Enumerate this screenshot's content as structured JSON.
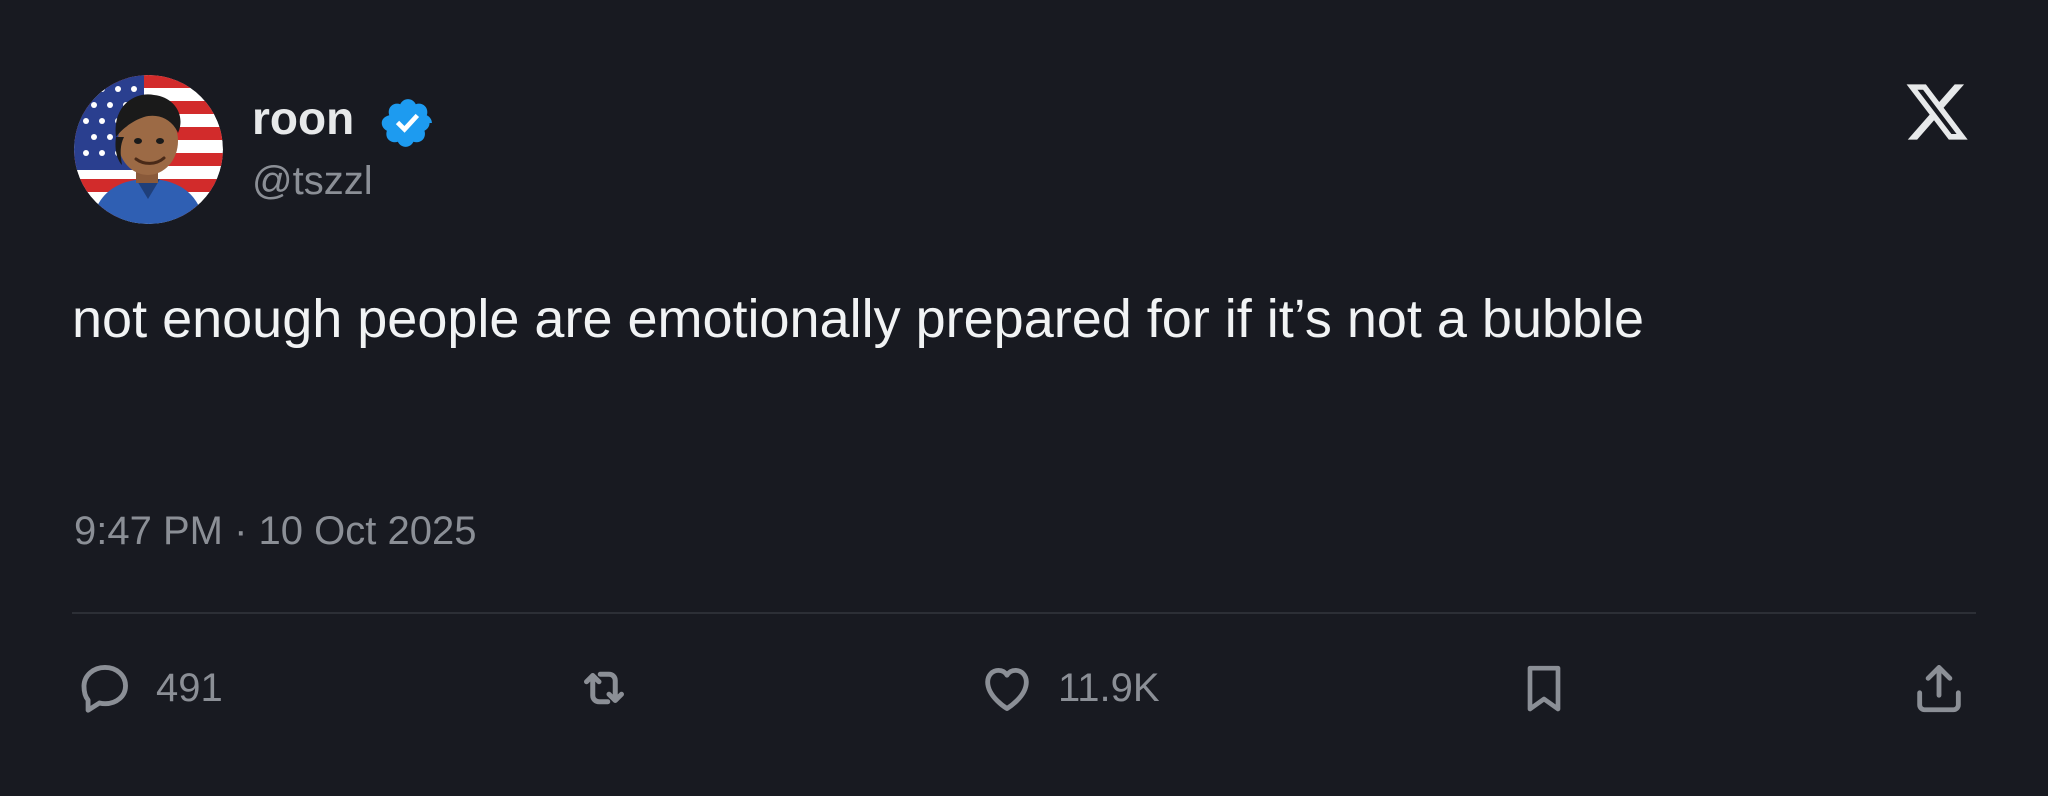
{
  "author": {
    "display_name": "roon",
    "handle": "@tszzl",
    "verified": true,
    "verified_color": "#1d9bf0",
    "avatar_icon": "avatar"
  },
  "tweet": {
    "text": "not enough people are emotionally prepared for if it’s not a bubble",
    "timestamp": "9:47 PM · 10 Oct 2025"
  },
  "actions": {
    "reply": {
      "icon": "reply-icon",
      "count": "491"
    },
    "retweet": {
      "icon": "retweet-icon"
    },
    "like": {
      "icon": "heart-icon",
      "count": "11.9K"
    },
    "bookmark": {
      "icon": "bookmark-icon"
    },
    "share": {
      "icon": "share-icon"
    }
  },
  "theme": {
    "background": "#181a21",
    "text_primary": "#e7e9ea",
    "text_secondary": "#8b8f96",
    "divider": "#2c2f36"
  }
}
